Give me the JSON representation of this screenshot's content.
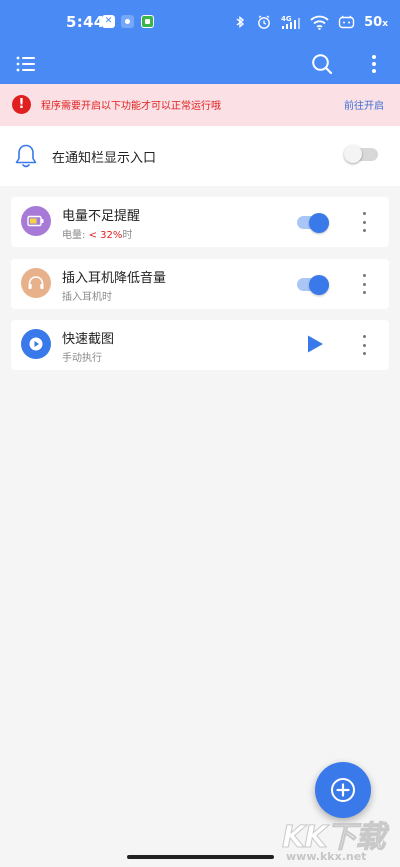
{
  "status_bar": {
    "time": "5:44",
    "network_label": "4G",
    "battery_pct": "50"
  },
  "app_bar": {
    "menu_icon": "list-menu-icon",
    "search_icon": "search-icon",
    "more_icon": "more-vertical-icon",
    "color": "#4a8af4"
  },
  "warning": {
    "text": "程序需要开启以下功能才可以正常运行哦",
    "action": "前往开启",
    "color": "#e02020",
    "background": "#fbe1e5"
  },
  "notification_entry": {
    "label": "在通知栏显示入口",
    "enabled": false
  },
  "tasks": [
    {
      "title": "电量不足提醒",
      "sub_prefix": "电量: ",
      "sub_value": "< 32%",
      "sub_suffix": "时",
      "icon": "battery-icon",
      "icon_color": "#a87ad8",
      "control": "toggle",
      "enabled": true
    },
    {
      "title": "插入耳机降低音量",
      "sub_prefix": "插入耳机时",
      "icon": "headphones-icon",
      "icon_color": "#e7b18c",
      "control": "toggle",
      "enabled": true
    },
    {
      "title": "快速截图",
      "sub_prefix": "手动执行",
      "icon": "screenshot-icon",
      "icon_color": "#3a79ea",
      "control": "play"
    }
  ],
  "fab": {
    "icon": "add-icon"
  },
  "watermark": {
    "text": "KK下载",
    "url": "www.kkx.net"
  }
}
